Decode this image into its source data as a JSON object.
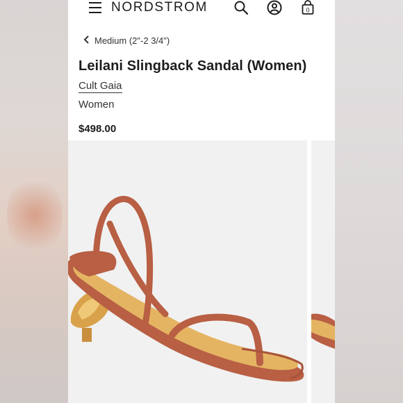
{
  "header": {
    "brand": "NORDSTROM"
  },
  "breadcrumb": {
    "label": "Medium (2\"-2 3/4\")"
  },
  "product": {
    "title": "Leilani Slingback Sandal (Women)",
    "brand": "Cult Gaia",
    "category": "Women",
    "price": "$498.00"
  },
  "icons": {
    "menu": "hamburger-menu-icon",
    "search": "search-icon",
    "account": "account-icon",
    "bag": "shopping-bag-icon",
    "back": "chevron-left-icon"
  },
  "bag": {
    "count": "0"
  },
  "colors": {
    "leather": "#b8624a",
    "insole": "#e5b463",
    "heel": "#d9a14a",
    "text": "#1c1c1c"
  }
}
